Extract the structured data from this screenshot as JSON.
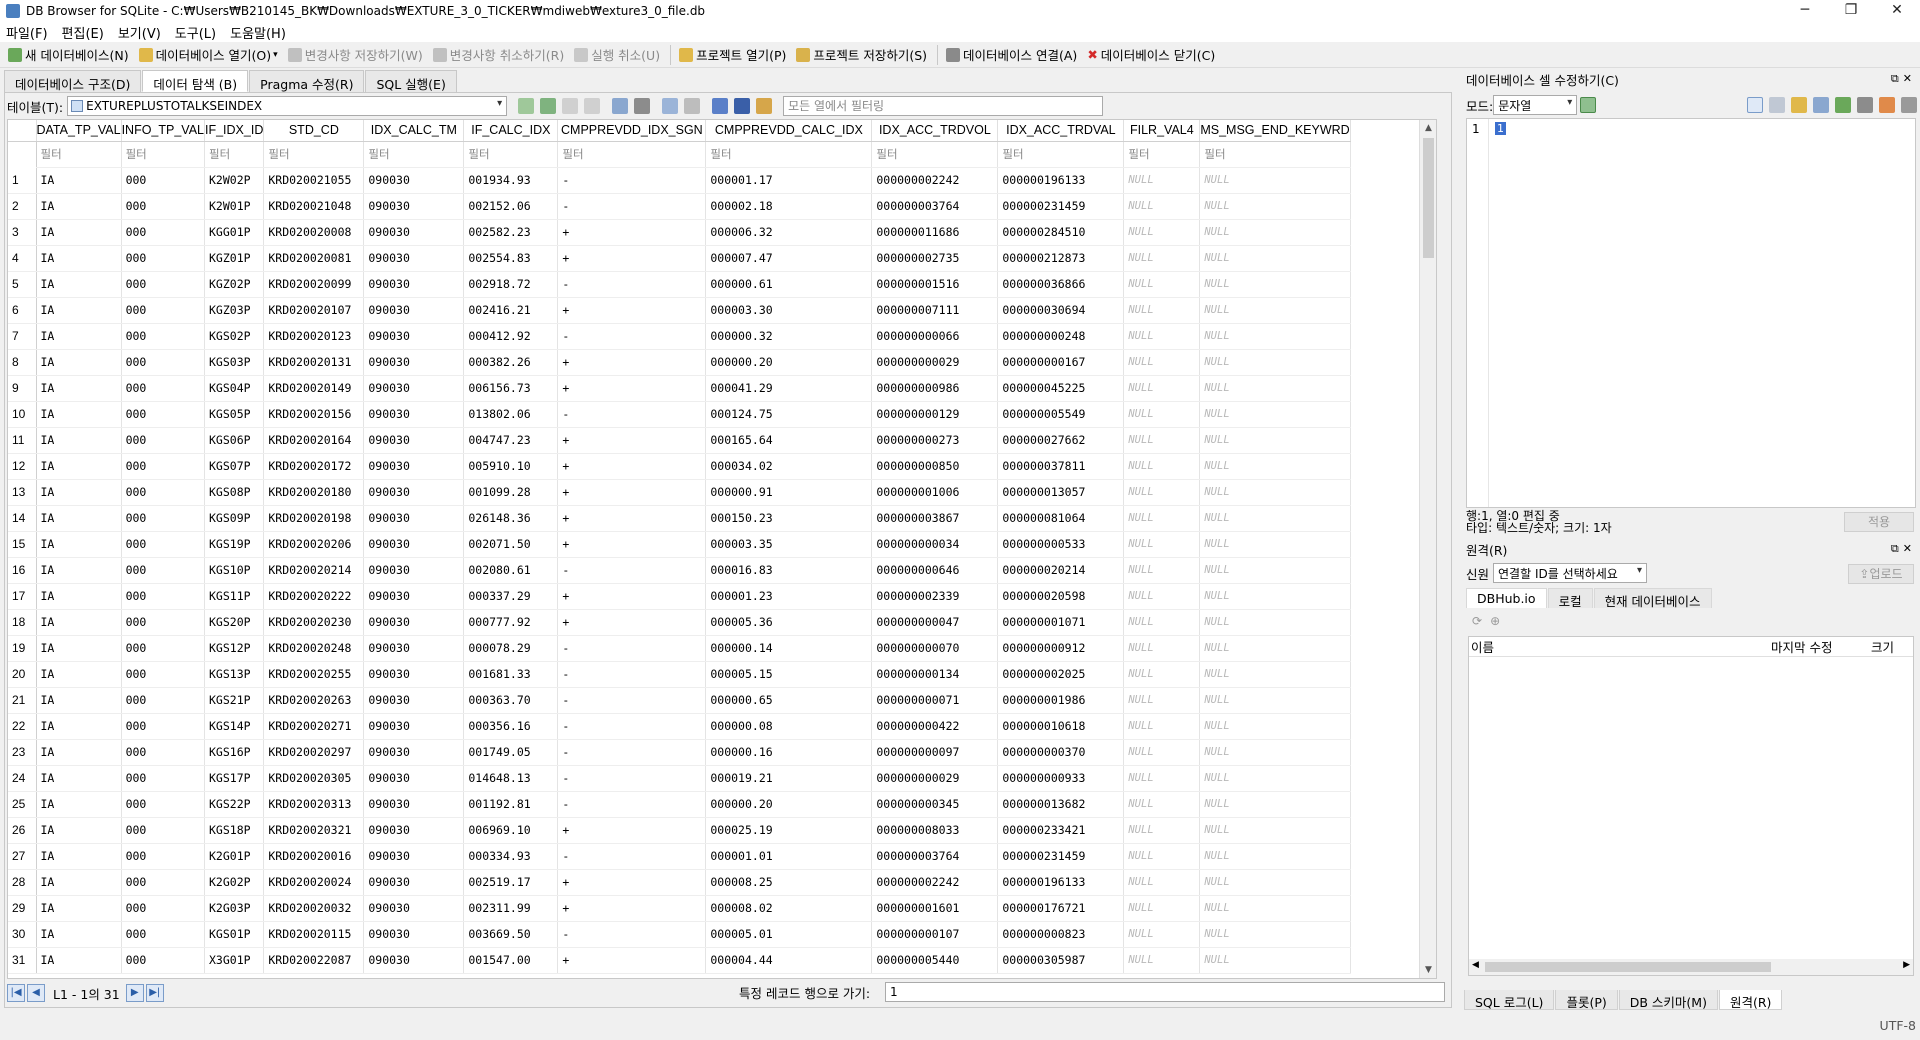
{
  "window": {
    "title": "DB Browser for SQLite - C:₩Users₩B210145_BK₩Downloads₩EXTURE_3_0_TICKER₩mdiweb₩exture3_0_file.db",
    "min": "─",
    "max": "❐",
    "close": "✕"
  },
  "menu": [
    "파일(F)",
    "편집(E)",
    "보기(V)",
    "도구(L)",
    "도움말(H)"
  ],
  "toolbar": {
    "new_db": "새 데이터베이스(N)",
    "open_db": "데이터베이스 열기(O)",
    "write_changes": "변경사항 저장하기(W)",
    "revert_changes": "변경사항 취소하기(R)",
    "undo": "실행 취소(U)",
    "open_project": "프로젝트 열기(P)",
    "save_project": "프로젝트 저장하기(S)",
    "attach_db": "데이터베이스 연결(A)",
    "close_db": "데이터베이스 닫기(C)"
  },
  "tabs": [
    "데이터베이스 구조(D)",
    "데이터 탐색 (B)",
    "Pragma 수정(R)",
    "SQL 실행(E)"
  ],
  "browse": {
    "table_label": "테이블(T):",
    "table_name": "EXTUREPLUSTOTALKSEINDEX",
    "filter_placeholder": "모든 열에서 필터링",
    "filter_cell": "필터",
    "columns": [
      "DATA_TP_VAL",
      "INFO_TP_VAL",
      "IF_IDX_ID",
      "STD_CD",
      "IDX_CALC_TM",
      "IF_CALC_IDX",
      "CMPPREVDD_IDX_SGN",
      "CMPPREVDD_CALC_IDX",
      "IDX_ACC_TRDVOL",
      "IDX_ACC_TRDVAL",
      "FILR_VAL4",
      "MS_MSG_END_KEYWRD"
    ],
    "rows": [
      [
        "1",
        "IA",
        "000",
        "K2W02P",
        "KRD020021055",
        "090030",
        "001934.93",
        "-",
        "000001.17",
        "000000002242",
        "000000196133",
        "NULL",
        "NULL"
      ],
      [
        "2",
        "IA",
        "000",
        "K2W01P",
        "KRD020021048",
        "090030",
        "002152.06",
        "-",
        "000002.18",
        "000000003764",
        "000000231459",
        "NULL",
        "NULL"
      ],
      [
        "3",
        "IA",
        "000",
        "KGG01P",
        "KRD020020008",
        "090030",
        "002582.23",
        "+",
        "000006.32",
        "000000011686",
        "000000284510",
        "NULL",
        "NULL"
      ],
      [
        "4",
        "IA",
        "000",
        "KGZ01P",
        "KRD020020081",
        "090030",
        "002554.83",
        "+",
        "000007.47",
        "000000002735",
        "000000212873",
        "NULL",
        "NULL"
      ],
      [
        "5",
        "IA",
        "000",
        "KGZ02P",
        "KRD020020099",
        "090030",
        "002918.72",
        "-",
        "000000.61",
        "000000001516",
        "000000036866",
        "NULL",
        "NULL"
      ],
      [
        "6",
        "IA",
        "000",
        "KGZ03P",
        "KRD020020107",
        "090030",
        "002416.21",
        "+",
        "000003.30",
        "000000007111",
        "000000030694",
        "NULL",
        "NULL"
      ],
      [
        "7",
        "IA",
        "000",
        "KGS02P",
        "KRD020020123",
        "090030",
        "000412.92",
        "-",
        "000000.32",
        "000000000066",
        "000000000248",
        "NULL",
        "NULL"
      ],
      [
        "8",
        "IA",
        "000",
        "KGS03P",
        "KRD020020131",
        "090030",
        "000382.26",
        "+",
        "000000.20",
        "000000000029",
        "000000000167",
        "NULL",
        "NULL"
      ],
      [
        "9",
        "IA",
        "000",
        "KGS04P",
        "KRD020020149",
        "090030",
        "006156.73",
        "+",
        "000041.29",
        "000000000986",
        "000000045225",
        "NULL",
        "NULL"
      ],
      [
        "10",
        "IA",
        "000",
        "KGS05P",
        "KRD020020156",
        "090030",
        "013802.06",
        "-",
        "000124.75",
        "000000000129",
        "000000005549",
        "NULL",
        "NULL"
      ],
      [
        "11",
        "IA",
        "000",
        "KGS06P",
        "KRD020020164",
        "090030",
        "004747.23",
        "+",
        "000165.64",
        "000000000273",
        "000000027662",
        "NULL",
        "NULL"
      ],
      [
        "12",
        "IA",
        "000",
        "KGS07P",
        "KRD020020172",
        "090030",
        "005910.10",
        "+",
        "000034.02",
        "000000000850",
        "000000037811",
        "NULL",
        "NULL"
      ],
      [
        "13",
        "IA",
        "000",
        "KGS08P",
        "KRD020020180",
        "090030",
        "001099.28",
        "+",
        "000000.91",
        "000000001006",
        "000000013057",
        "NULL",
        "NULL"
      ],
      [
        "14",
        "IA",
        "000",
        "KGS09P",
        "KRD020020198",
        "090030",
        "026148.36",
        "+",
        "000150.23",
        "000000003867",
        "000000081064",
        "NULL",
        "NULL"
      ],
      [
        "15",
        "IA",
        "000",
        "KGS19P",
        "KRD020020206",
        "090030",
        "002071.50",
        "+",
        "000003.35",
        "000000000034",
        "000000000533",
        "NULL",
        "NULL"
      ],
      [
        "16",
        "IA",
        "000",
        "KGS10P",
        "KRD020020214",
        "090030",
        "002080.61",
        "-",
        "000016.83",
        "000000000646",
        "000000020214",
        "NULL",
        "NULL"
      ],
      [
        "17",
        "IA",
        "000",
        "KGS11P",
        "KRD020020222",
        "090030",
        "000337.29",
        "+",
        "000001.23",
        "000000002339",
        "000000020598",
        "NULL",
        "NULL"
      ],
      [
        "18",
        "IA",
        "000",
        "KGS20P",
        "KRD020020230",
        "090030",
        "000777.92",
        "+",
        "000005.36",
        "000000000047",
        "000000001071",
        "NULL",
        "NULL"
      ],
      [
        "19",
        "IA",
        "000",
        "KGS12P",
        "KRD020020248",
        "090030",
        "000078.29",
        "-",
        "000000.14",
        "000000000070",
        "000000000912",
        "NULL",
        "NULL"
      ],
      [
        "20",
        "IA",
        "000",
        "KGS13P",
        "KRD020020255",
        "090030",
        "001681.33",
        "-",
        "000005.15",
        "000000000134",
        "000000002025",
        "NULL",
        "NULL"
      ],
      [
        "21",
        "IA",
        "000",
        "KGS21P",
        "KRD020020263",
        "090030",
        "000363.70",
        "-",
        "000000.65",
        "000000000071",
        "000000001986",
        "NULL",
        "NULL"
      ],
      [
        "22",
        "IA",
        "000",
        "KGS14P",
        "KRD020020271",
        "090030",
        "000356.16",
        "-",
        "000000.08",
        "000000000422",
        "000000010618",
        "NULL",
        "NULL"
      ],
      [
        "23",
        "IA",
        "000",
        "KGS16P",
        "KRD020020297",
        "090030",
        "001749.05",
        "-",
        "000000.16",
        "000000000097",
        "000000000370",
        "NULL",
        "NULL"
      ],
      [
        "24",
        "IA",
        "000",
        "KGS17P",
        "KRD020020305",
        "090030",
        "014648.13",
        "-",
        "000019.21",
        "000000000029",
        "000000000933",
        "NULL",
        "NULL"
      ],
      [
        "25",
        "IA",
        "000",
        "KGS22P",
        "KRD020020313",
        "090030",
        "001192.81",
        "-",
        "000000.20",
        "000000000345",
        "000000013682",
        "NULL",
        "NULL"
      ],
      [
        "26",
        "IA",
        "000",
        "KGS18P",
        "KRD020020321",
        "090030",
        "006969.10",
        "+",
        "000025.19",
        "000000008033",
        "000000233421",
        "NULL",
        "NULL"
      ],
      [
        "27",
        "IA",
        "000",
        "K2G01P",
        "KRD020020016",
        "090030",
        "000334.93",
        "-",
        "000001.01",
        "000000003764",
        "000000231459",
        "NULL",
        "NULL"
      ],
      [
        "28",
        "IA",
        "000",
        "K2G02P",
        "KRD020020024",
        "090030",
        "002519.17",
        "+",
        "000008.25",
        "000000002242",
        "000000196133",
        "NULL",
        "NULL"
      ],
      [
        "29",
        "IA",
        "000",
        "K2G03P",
        "KRD020020032",
        "090030",
        "002311.99",
        "+",
        "000008.02",
        "000000001601",
        "000000176721",
        "NULL",
        "NULL"
      ],
      [
        "30",
        "IA",
        "000",
        "KGS01P",
        "KRD020020115",
        "090030",
        "003669.50",
        "-",
        "000005.01",
        "000000000107",
        "000000000823",
        "NULL",
        "NULL"
      ],
      [
        "31",
        "IA",
        "000",
        "X3G01P",
        "KRD020022087",
        "090030",
        "001547.00",
        "+",
        "000004.44",
        "000000005440",
        "000000305987",
        "NULL",
        "NULL"
      ]
    ],
    "nav_text": "L1 - 1의 31",
    "goto_label": "특정 레코드 행으로 가기:",
    "goto_value": "1"
  },
  "edit_cell": {
    "title": "데이터베이스 셀 수정하기(C)",
    "mode_label": "모드:",
    "mode_value": "문자열",
    "line_number": "1",
    "cursor_value": "1",
    "status_line1": "행:1, 열:0 편집 중",
    "status_line2": "타입: 텍스트/숫자; 크기: 1자",
    "apply": "적용"
  },
  "remote": {
    "title": "원격(R)",
    "identity_label": "신원",
    "identity_value": "연결할 ID를 선택하세요",
    "upload": "업로드",
    "tabs": [
      "DBHub.io",
      "로컬",
      "현재 데이터베이스"
    ],
    "col_name": "이름",
    "col_modified": "마지막 수정",
    "col_size": "크기"
  },
  "bottom_tabs": [
    "SQL 로그(L)",
    "플롯(P)",
    "DB 스키마(M)",
    "원격(R)"
  ],
  "encoding": "UTF-8"
}
